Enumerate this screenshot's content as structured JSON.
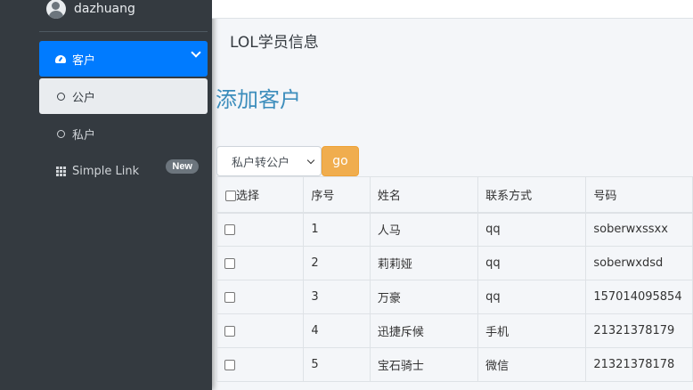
{
  "sidebar": {
    "username": "dazhuang",
    "items": [
      {
        "label": "客户"
      },
      {
        "label": "公户"
      },
      {
        "label": "私户"
      },
      {
        "label": "Simple Link",
        "badge": "New"
      }
    ]
  },
  "header": {
    "title": "LOL学员信息"
  },
  "main": {
    "heading": "添加客户",
    "action_select": "私户转公户",
    "go_label": "go"
  },
  "table": {
    "headers": [
      "选择",
      "序号",
      "姓名",
      "联系方式",
      "号码"
    ],
    "rows": [
      [
        "1",
        "人马",
        "qq",
        "soberwxssxx"
      ],
      [
        "2",
        "莉莉娅",
        "qq",
        "soberwxdsd"
      ],
      [
        "3",
        "万豪",
        "qq",
        "157014095854"
      ],
      [
        "4",
        "迅捷斥候",
        "手机",
        "21321378179"
      ],
      [
        "5",
        "宝石骑士",
        "微信",
        "21321378178"
      ]
    ]
  }
}
